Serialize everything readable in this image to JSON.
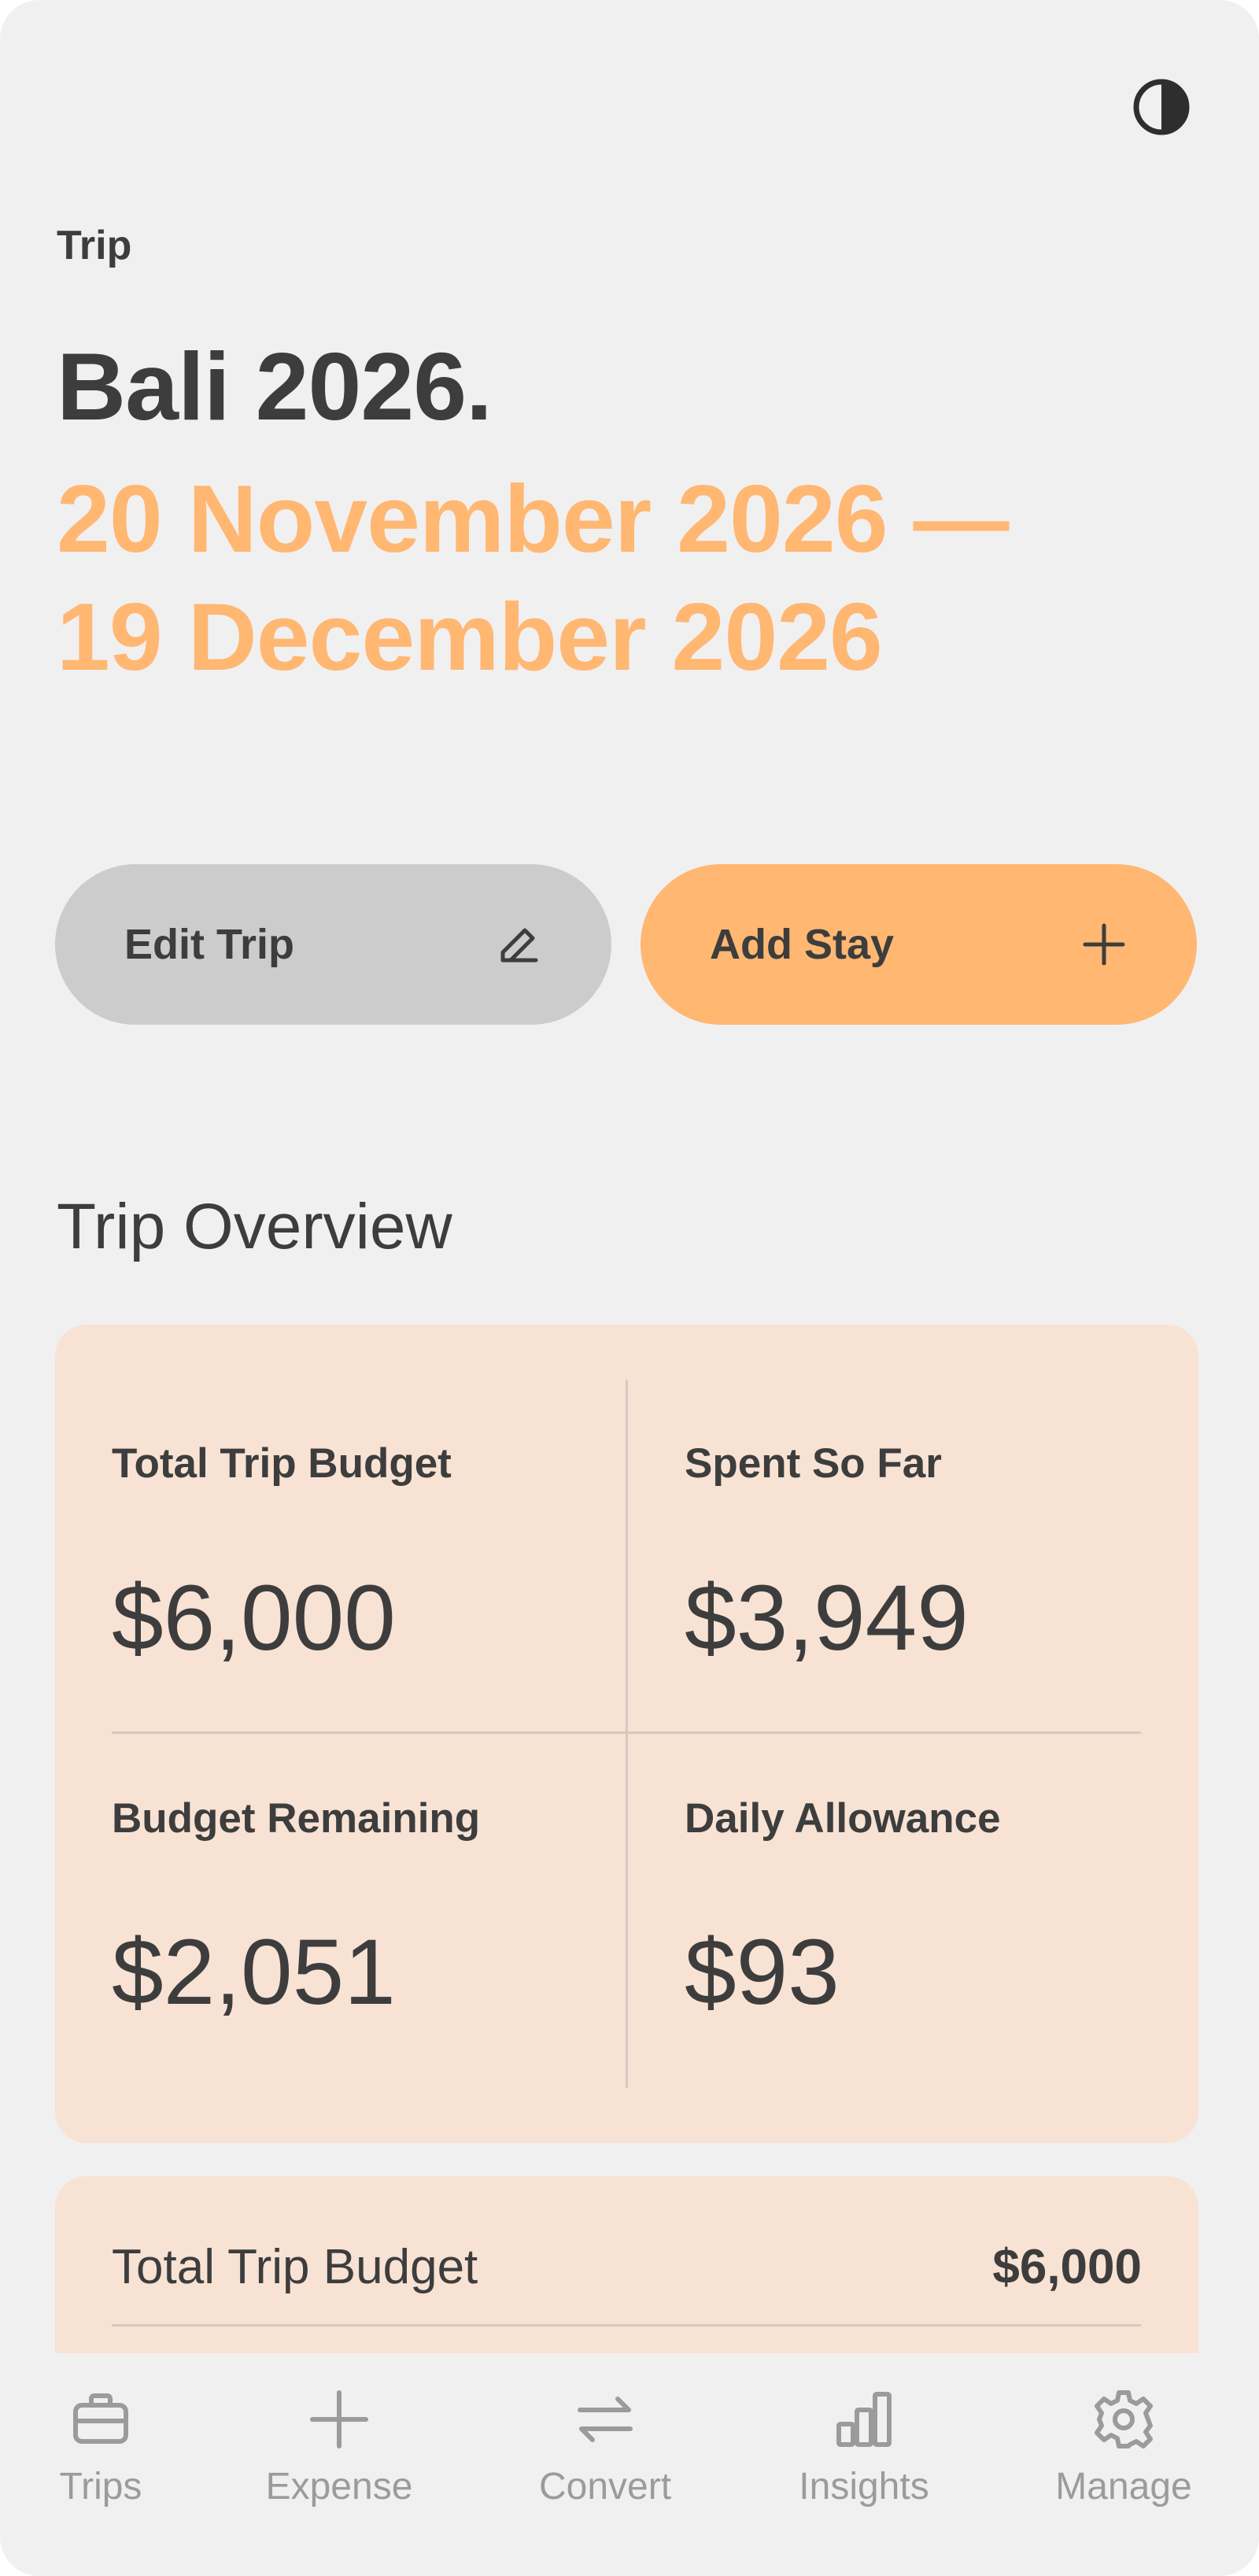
{
  "header": {
    "theme_toggle_icon": "half-circle-contrast-icon",
    "section_label": "Trip",
    "trip_name": "Bali 2026.",
    "date_start": "20 November 2026 —",
    "date_end": "19 December 2026"
  },
  "actions": {
    "edit_label": "Edit Trip",
    "edit_icon": "pencil-icon",
    "add_label": "Add Stay",
    "add_icon": "plus-icon"
  },
  "overview": {
    "title": "Trip Overview",
    "stats": [
      {
        "label": "Total Trip Budget",
        "value": "$6,000"
      },
      {
        "label": "Spent So Far",
        "value": "$3,949"
      },
      {
        "label": "Budget Remaining",
        "value": "$2,051"
      },
      {
        "label": "Daily Allowance",
        "value": "$93"
      }
    ]
  },
  "budget_rows": [
    {
      "label": "Total Trip Budget",
      "value": "$6,000"
    }
  ],
  "nav": [
    {
      "label": "Trips",
      "icon": "briefcase-icon"
    },
    {
      "label": "Expense",
      "icon": "plus-icon"
    },
    {
      "label": "Convert",
      "icon": "swap-arrows-icon"
    },
    {
      "label": "Insights",
      "icon": "bar-chart-icon"
    },
    {
      "label": "Manage",
      "icon": "gear-icon"
    }
  ],
  "colors": {
    "background": "#f1f0f1",
    "accent": "#ffb772",
    "card": "#f7e2d4",
    "button_neutral": "#cccccc",
    "text": "#3d3d3d",
    "nav_text": "#9b9b9b"
  }
}
